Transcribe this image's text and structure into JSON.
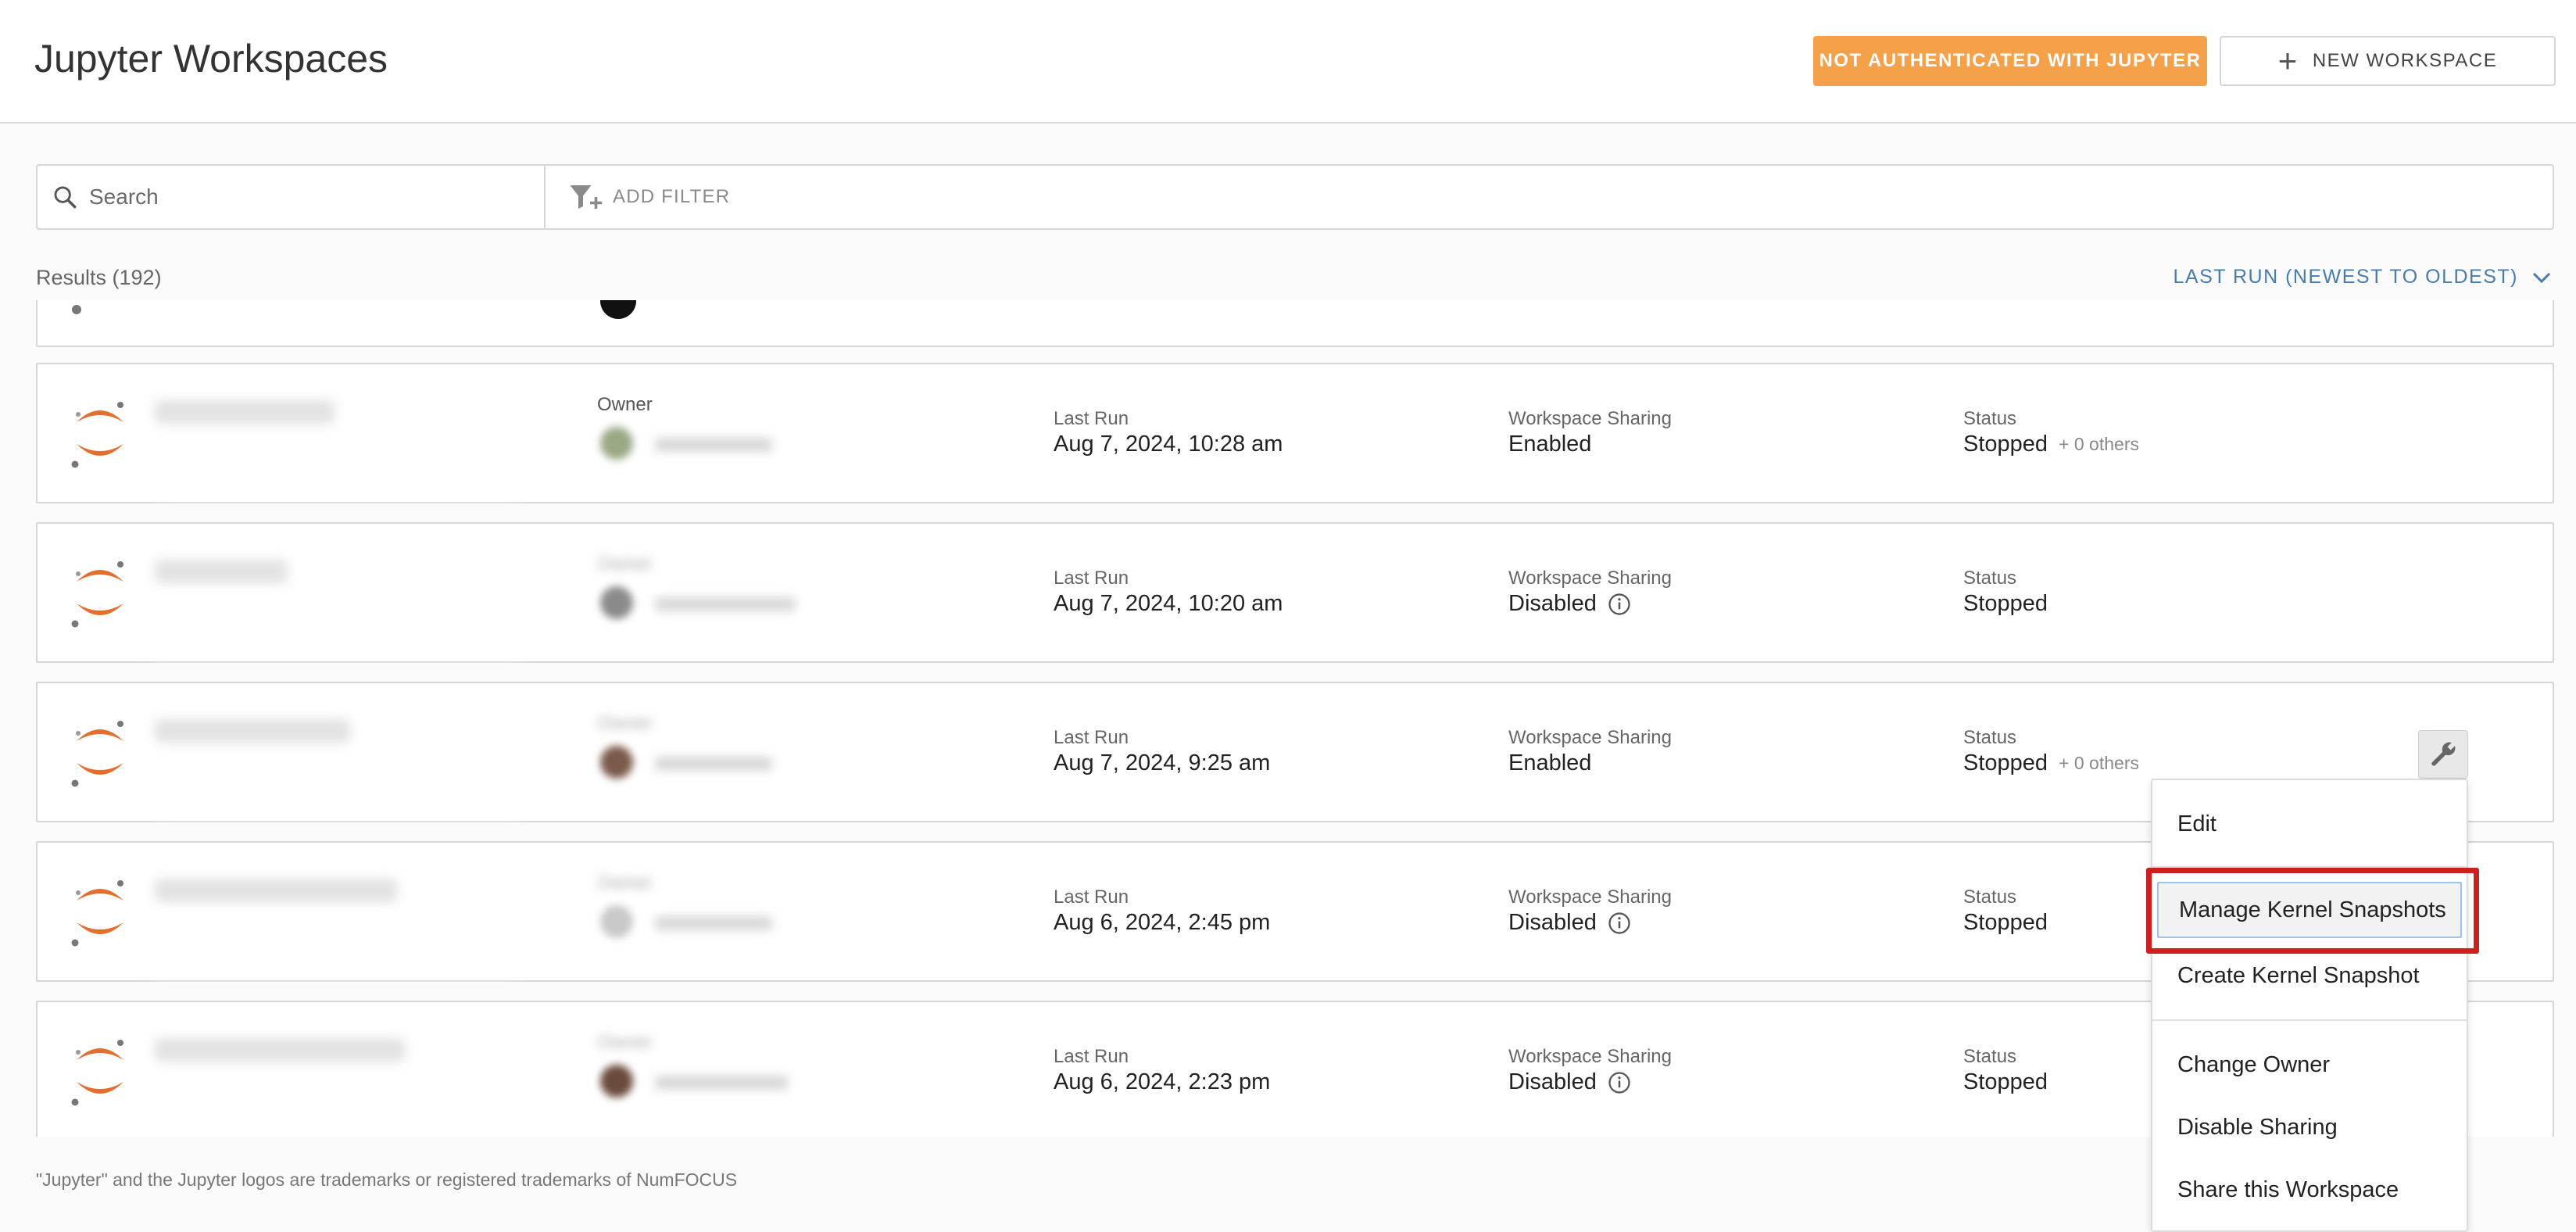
{
  "header": {
    "title": "Jupyter Workspaces",
    "auth_button": "NOT AUTHENTICATED WITH JUPYTER",
    "new_button": "NEW WORKSPACE"
  },
  "search": {
    "placeholder": "Search",
    "add_filter": "ADD FILTER"
  },
  "results": {
    "count_label": "Results (192)",
    "sort_label": "LAST RUN (NEWEST TO OLDEST)"
  },
  "labels": {
    "owner": "Owner",
    "last_run": "Last Run",
    "sharing": "Workspace Sharing",
    "status": "Status"
  },
  "rows": [
    {
      "last_run": "Aug 7, 2024, 10:28 am",
      "sharing": "Enabled",
      "status": "Stopped",
      "extra": "+ 0 others",
      "avatar_color": "#9aa884"
    },
    {
      "last_run": "Aug 7, 2024, 10:20 am",
      "sharing": "Disabled",
      "status": "Stopped",
      "extra": "",
      "avatar_color": "#8a8a8a"
    },
    {
      "last_run": "Aug 7, 2024, 9:25 am",
      "sharing": "Enabled",
      "status": "Stopped",
      "extra": "+ 0 others",
      "avatar_color": "#7a5a4a"
    },
    {
      "last_run": "Aug 6, 2024, 2:45 pm",
      "sharing": "Disabled",
      "status": "Stopped",
      "extra": "",
      "avatar_color": "#c9c9c9"
    },
    {
      "last_run": "Aug 6, 2024, 2:23 pm",
      "sharing": "Disabled",
      "status": "Stopped",
      "extra": "",
      "avatar_color": "#6a4a3a"
    }
  ],
  "menu": {
    "edit": "Edit",
    "manage_snapshots": "Manage Kernel Snapshots",
    "create_snapshot": "Create Kernel Snapshot",
    "change_owner": "Change Owner",
    "disable_sharing": "Disable Sharing",
    "share": "Share this Workspace"
  },
  "footer": "\"Jupyter\" and the Jupyter logos are trademarks or registered trademarks of NumFOCUS",
  "colors": {
    "accent_orange": "#f5a14a",
    "link_blue": "#4a7cab",
    "highlight_red": "#cc2020",
    "jupyter_orange": "#e46e2e"
  }
}
